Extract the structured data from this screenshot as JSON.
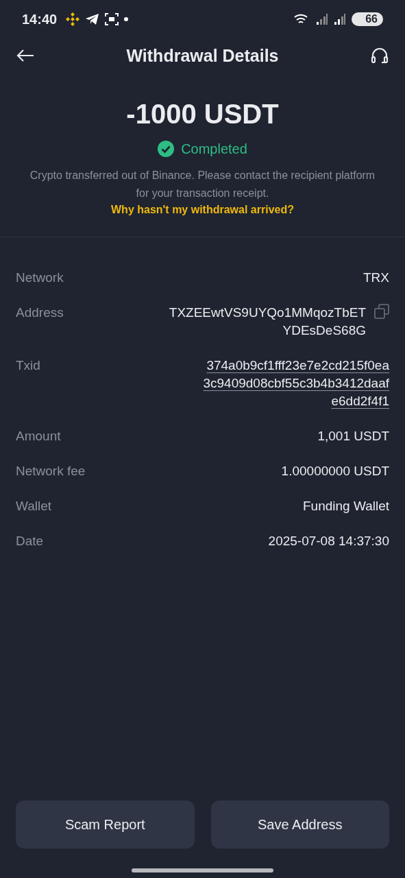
{
  "status_bar": {
    "time": "14:40",
    "battery": "66"
  },
  "header": {
    "title": "Withdrawal Details"
  },
  "summary": {
    "amount": "-1000 USDT",
    "status": "Completed",
    "note": "Crypto transferred out of Binance. Please contact the recipient platform for your transaction receipt.",
    "help_link": "Why hasn't my withdrawal arrived?"
  },
  "details": [
    {
      "kind": "plain",
      "label": "Network",
      "lines": [
        "TRX"
      ]
    },
    {
      "kind": "copy",
      "label": "Address",
      "lines": [
        "TXZEEwtVS9UYQo1MMqozTbET",
        "YDEsDeS68G"
      ]
    },
    {
      "kind": "link",
      "label": "Txid",
      "lines": [
        "374a0b9cf1fff23e7e2cd215f0ea",
        "3c9409d08cbf55c3b4b3412daaf",
        "e6dd2f4f1"
      ]
    },
    {
      "kind": "plain",
      "label": "Amount",
      "lines": [
        "1,001 USDT"
      ]
    },
    {
      "kind": "plain",
      "label": "Network fee",
      "lines": [
        "1.00000000 USDT"
      ]
    },
    {
      "kind": "plain",
      "label": "Wallet",
      "lines": [
        "Funding Wallet"
      ]
    },
    {
      "kind": "plain",
      "label": "Date",
      "lines": [
        "2025-07-08 14:37:30"
      ]
    }
  ],
  "buttons": [
    "Scam Report",
    "Save Address"
  ]
}
